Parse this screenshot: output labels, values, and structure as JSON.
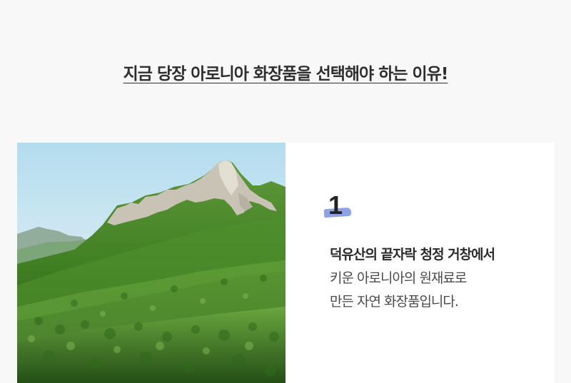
{
  "headline": "지금 당장 아로니아 화장품을 선택해야 하는 이유!",
  "feature": {
    "number": "1",
    "title": "덕유산의 끝자락 청정 거창에서",
    "lines": [
      "키운 아로니아의 원재료로",
      "만든 자연 화장품입니다."
    ]
  },
  "colors": {
    "page_background": "#f8f8f8",
    "card_background": "#ffffff",
    "number_highlight": "#8ea2e6",
    "text": "#333333"
  }
}
